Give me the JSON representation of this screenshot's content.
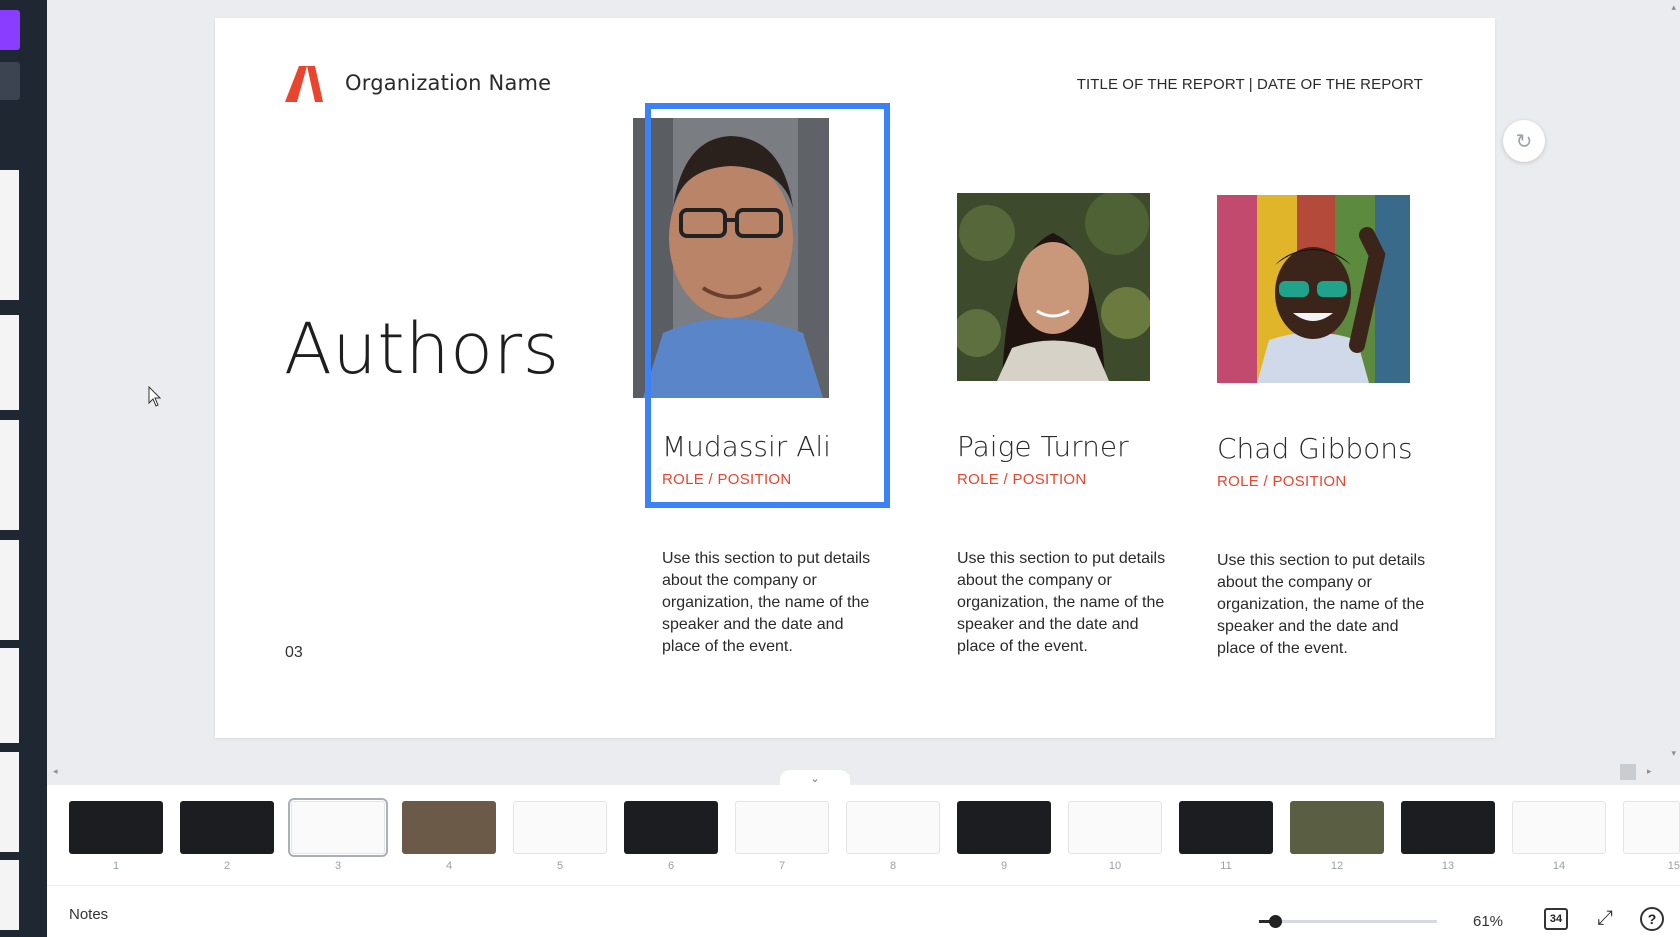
{
  "slide": {
    "org_name": "Organization Name",
    "report_title": "TITLE OF THE REPORT | DATE OF THE REPORT",
    "heading": "Authors",
    "page_number": "03",
    "authors": [
      {
        "name": "Mudassir Ali",
        "role": "ROLE / POSITION",
        "description": "Use this section to put details about the company or organization, the name of the speaker and the date and place of the event."
      },
      {
        "name": "Paige Turner",
        "role": "ROLE / POSITION",
        "description": "Use this section to put details about the company or organization, the name of the speaker and the date and place of the event."
      },
      {
        "name": "Chad Gibbons",
        "role": "ROLE / POSITION",
        "description": "Use this section to put details about the company or organization, the name of the speaker and the date and place of the event."
      }
    ]
  },
  "filmstrip": {
    "toggle_icon": "chevron-down-icon",
    "thumbnails": [
      {
        "number": "1",
        "style": "dark"
      },
      {
        "number": "2",
        "style": "dark"
      },
      {
        "number": "3",
        "style": "light",
        "selected": true
      },
      {
        "number": "4",
        "style": "photo"
      },
      {
        "number": "5",
        "style": "light"
      },
      {
        "number": "6",
        "style": "dark"
      },
      {
        "number": "7",
        "style": "light"
      },
      {
        "number": "8",
        "style": "light"
      },
      {
        "number": "9",
        "style": "dark"
      },
      {
        "number": "10",
        "style": "light"
      },
      {
        "number": "11",
        "style": "dark"
      },
      {
        "number": "12",
        "style": "photo"
      },
      {
        "number": "13",
        "style": "dark"
      },
      {
        "number": "14",
        "style": "light"
      },
      {
        "number": "15",
        "style": "light"
      }
    ]
  },
  "bottombar": {
    "notes_label": "Notes",
    "zoom_label": "61%",
    "zoom_level_percent": 61,
    "zoom_slider_fraction": 0.09,
    "pages_count": "34",
    "help_label": "?"
  },
  "colors": {
    "accent_blue": "#3b82f6",
    "role_red": "#e8442e",
    "logo_red": "#e8442e",
    "sidebar_dark": "#1f2733"
  }
}
